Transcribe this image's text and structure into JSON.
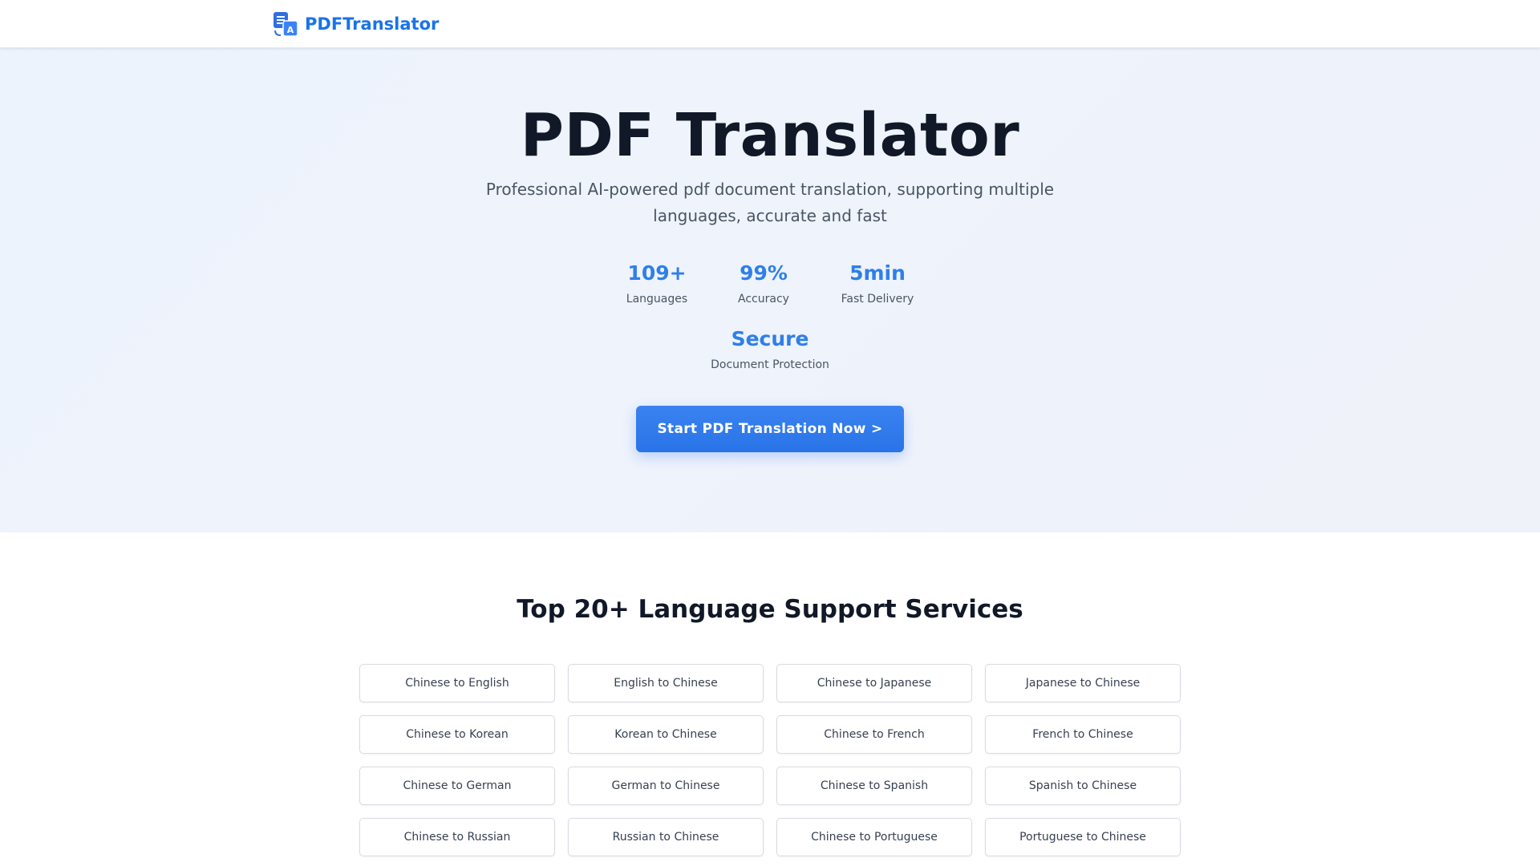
{
  "header": {
    "brand_name": "PDFTranslator",
    "logo_icon": "translate-document-icon",
    "brand_color": "#1a73e8"
  },
  "hero": {
    "title": "PDF Translator",
    "subtitle": "Professional AI-powered pdf document translation, supporting multiple languages, accurate and fast",
    "stats": [
      {
        "value": "109+",
        "label": "Languages"
      },
      {
        "value": "99%",
        "label": "Accuracy"
      },
      {
        "value": "5min",
        "label": "Fast Delivery"
      },
      {
        "value": "Secure",
        "label": "Document Protection"
      }
    ],
    "cta_label": "Start PDF Translation Now >",
    "accent_color": "#2f7fe8"
  },
  "services": {
    "title": "Top 20+ Language Support Services",
    "items": [
      "Chinese to English",
      "English to Chinese",
      "Chinese to Japanese",
      "Japanese to Chinese",
      "Chinese to Korean",
      "Korean to Chinese",
      "Chinese to French",
      "French to Chinese",
      "Chinese to German",
      "German to Chinese",
      "Chinese to Spanish",
      "Spanish to Chinese",
      "Chinese to Russian",
      "Russian to Chinese",
      "Chinese to Portuguese",
      "Portuguese to Chinese"
    ]
  }
}
